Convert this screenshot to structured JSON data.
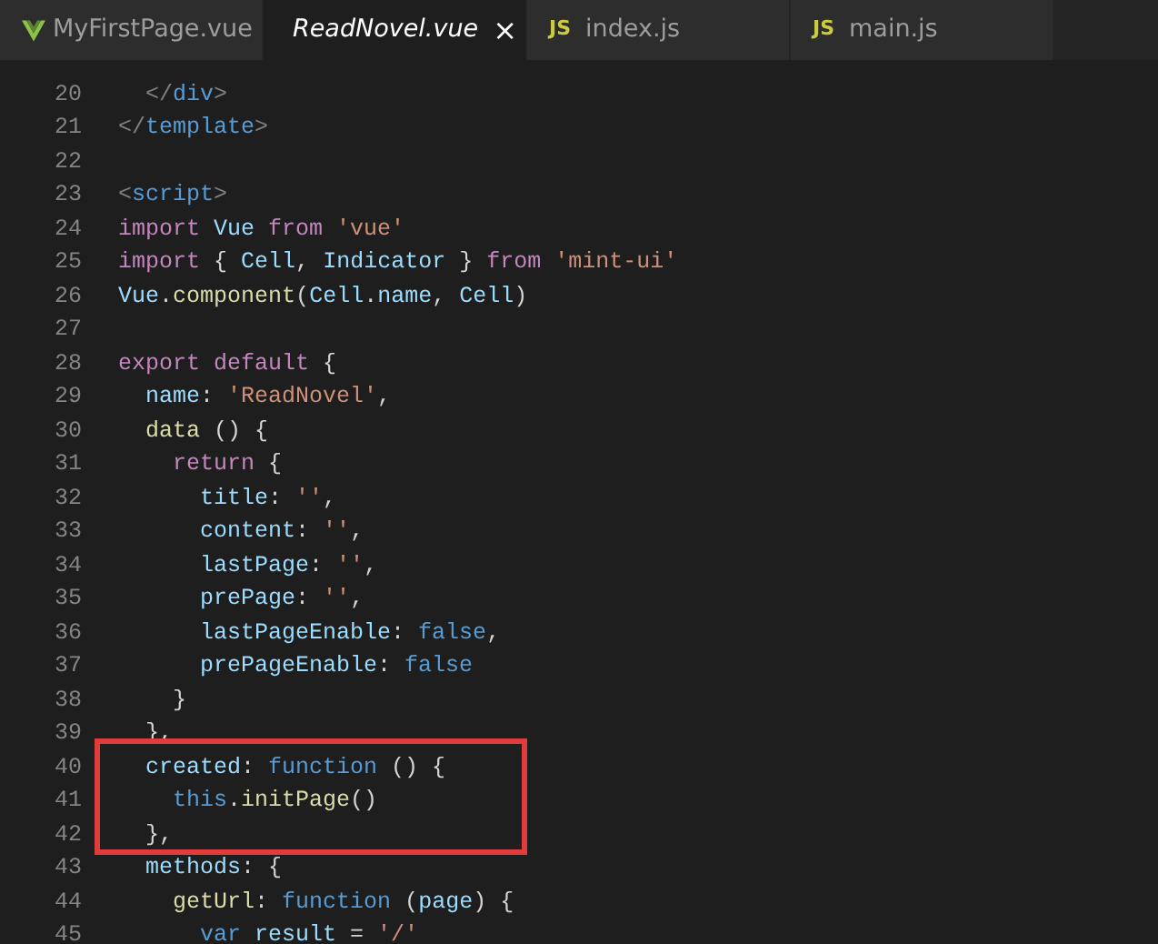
{
  "tabs": [
    {
      "label": "MyFirstPage.vue",
      "kind": "vue",
      "selected": false,
      "preview": false
    },
    {
      "label": "ReadNovel.vue",
      "kind": "vue",
      "selected": true,
      "preview": true,
      "close": "×"
    },
    {
      "label": "index.js",
      "kind": "js",
      "selected": false,
      "preview": false,
      "icon_text": "JS"
    },
    {
      "label": "main.js",
      "kind": "js",
      "selected": false,
      "preview": false,
      "icon_text": "JS"
    }
  ],
  "lines": [
    {
      "number": "20",
      "highlighted": false,
      "tokens": [
        {
          "text": "  </",
          "kind": "b"
        },
        {
          "text": "div",
          "kind": "t"
        },
        {
          "text": ">",
          "kind": "b"
        }
      ]
    },
    {
      "number": "21",
      "highlighted": false,
      "tokens": [
        {
          "text": "</",
          "kind": "b"
        },
        {
          "text": "template",
          "kind": "t"
        },
        {
          "text": ">",
          "kind": "b"
        }
      ]
    },
    {
      "number": "22",
      "highlighted": false
    },
    {
      "number": "23",
      "highlighted": false,
      "tokens": [
        {
          "text": "<",
          "kind": "b"
        },
        {
          "text": "script",
          "kind": "t"
        },
        {
          "text": ">",
          "kind": "b"
        }
      ]
    },
    {
      "number": "24",
      "highlighted": false,
      "tokens": [
        {
          "text": "import",
          "kind": "k"
        },
        {
          "text": " Vue",
          "kind": "v"
        },
        {
          "text": " from",
          "kind": "k"
        },
        {
          "text": " 'vue'",
          "kind": "s"
        }
      ]
    },
    {
      "number": "25",
      "highlighted": false,
      "tokens": [
        {
          "text": "import",
          "kind": "k"
        },
        {
          "text": " { ",
          "kind": "p"
        },
        {
          "text": "Cell",
          "kind": "v"
        },
        {
          "text": ", ",
          "kind": "p"
        },
        {
          "text": "Indicator",
          "kind": "v"
        },
        {
          "text": " } ",
          "kind": "p"
        },
        {
          "text": "from",
          "kind": "k"
        },
        {
          "text": " 'mint-ui'",
          "kind": "s"
        }
      ]
    },
    {
      "number": "26",
      "highlighted": false,
      "tokens": [
        {
          "text": "Vue",
          "kind": "v"
        },
        {
          "text": ".",
          "kind": "p"
        },
        {
          "text": "component",
          "kind": "f"
        },
        {
          "text": "(",
          "kind": "p"
        },
        {
          "text": "Cell",
          "kind": "v"
        },
        {
          "text": ".",
          "kind": "p"
        },
        {
          "text": "name",
          "kind": "v"
        },
        {
          "text": ", ",
          "kind": "p"
        },
        {
          "text": "Cell",
          "kind": "v"
        },
        {
          "text": ")",
          "kind": "p"
        }
      ]
    },
    {
      "number": "27",
      "highlighted": false
    },
    {
      "number": "28",
      "highlighted": false,
      "tokens": [
        {
          "text": "export default",
          "kind": "k"
        },
        {
          "text": " {",
          "kind": "p"
        }
      ]
    },
    {
      "number": "29",
      "highlighted": false,
      "tokens": [
        {
          "text": "  name",
          "kind": "v"
        },
        {
          "text": ": ",
          "kind": "p"
        },
        {
          "text": "'ReadNovel'",
          "kind": "s"
        },
        {
          "text": ",",
          "kind": "p"
        }
      ]
    },
    {
      "number": "30",
      "highlighted": false,
      "tokens": [
        {
          "text": "  data",
          "kind": "f"
        },
        {
          "text": " () {",
          "kind": "p"
        }
      ]
    },
    {
      "number": "31",
      "highlighted": false,
      "tokens": [
        {
          "text": "    return",
          "kind": "k"
        },
        {
          "text": " {",
          "kind": "p"
        }
      ]
    },
    {
      "number": "32",
      "highlighted": false,
      "tokens": [
        {
          "text": "      title",
          "kind": "v"
        },
        {
          "text": ": ",
          "kind": "p"
        },
        {
          "text": "''",
          "kind": "s"
        },
        {
          "text": ",",
          "kind": "p"
        }
      ]
    },
    {
      "number": "33",
      "highlighted": false,
      "tokens": [
        {
          "text": "      content",
          "kind": "v"
        },
        {
          "text": ": ",
          "kind": "p"
        },
        {
          "text": "''",
          "kind": "s"
        },
        {
          "text": ",",
          "kind": "p"
        }
      ]
    },
    {
      "number": "34",
      "highlighted": false,
      "tokens": [
        {
          "text": "      lastPage",
          "kind": "v"
        },
        {
          "text": ": ",
          "kind": "p"
        },
        {
          "text": "''",
          "kind": "s"
        },
        {
          "text": ",",
          "kind": "p"
        }
      ]
    },
    {
      "number": "35",
      "highlighted": false,
      "tokens": [
        {
          "text": "      prePage",
          "kind": "v"
        },
        {
          "text": ": ",
          "kind": "p"
        },
        {
          "text": "''",
          "kind": "s"
        },
        {
          "text": ",",
          "kind": "p"
        }
      ]
    },
    {
      "number": "36",
      "highlighted": false,
      "tokens": [
        {
          "text": "      lastPageEnable",
          "kind": "v"
        },
        {
          "text": ": ",
          "kind": "p"
        },
        {
          "text": "false",
          "kind": "c"
        },
        {
          "text": ",",
          "kind": "p"
        }
      ]
    },
    {
      "number": "37",
      "highlighted": false,
      "tokens": [
        {
          "text": "      prePageEnable",
          "kind": "v"
        },
        {
          "text": ": ",
          "kind": "p"
        },
        {
          "text": "false",
          "kind": "c"
        }
      ]
    },
    {
      "number": "38",
      "highlighted": false,
      "tokens": [
        {
          "text": "    }",
          "kind": "p"
        }
      ]
    },
    {
      "number": "39",
      "highlighted": false,
      "tokens": [
        {
          "text": "  },",
          "kind": "p"
        }
      ]
    },
    {
      "number": "40",
      "highlighted": true,
      "tokens": [
        {
          "text": "  created",
          "kind": "v"
        },
        {
          "text": ": ",
          "kind": "p"
        },
        {
          "text": "function",
          "kind": "c"
        },
        {
          "text": " () {",
          "kind": "p"
        }
      ]
    },
    {
      "number": "41",
      "highlighted": true,
      "tokens": [
        {
          "text": "    this",
          "kind": "c"
        },
        {
          "text": ".",
          "kind": "p"
        },
        {
          "text": "initPage",
          "kind": "f"
        },
        {
          "text": "()",
          "kind": "p"
        }
      ]
    },
    {
      "number": "42",
      "highlighted": true,
      "tokens": [
        {
          "text": "  },",
          "kind": "p"
        }
      ]
    },
    {
      "number": "43",
      "highlighted": false,
      "tokens": [
        {
          "text": "  methods",
          "kind": "v"
        },
        {
          "text": ": {",
          "kind": "p"
        }
      ]
    },
    {
      "number": "44",
      "highlighted": false,
      "tokens": [
        {
          "text": "    getUrl",
          "kind": "f"
        },
        {
          "text": ": ",
          "kind": "p"
        },
        {
          "text": "function",
          "kind": "c"
        },
        {
          "text": " (",
          "kind": "p"
        },
        {
          "text": "page",
          "kind": "v"
        },
        {
          "text": ") {",
          "kind": "p"
        }
      ]
    },
    {
      "number": "45",
      "highlighted": false,
      "tokens": [
        {
          "text": "      var",
          "kind": "c"
        },
        {
          "text": " result",
          "kind": "v"
        },
        {
          "text": " = ",
          "kind": "p"
        },
        {
          "text": "'/'",
          "kind": "s"
        }
      ]
    }
  ]
}
